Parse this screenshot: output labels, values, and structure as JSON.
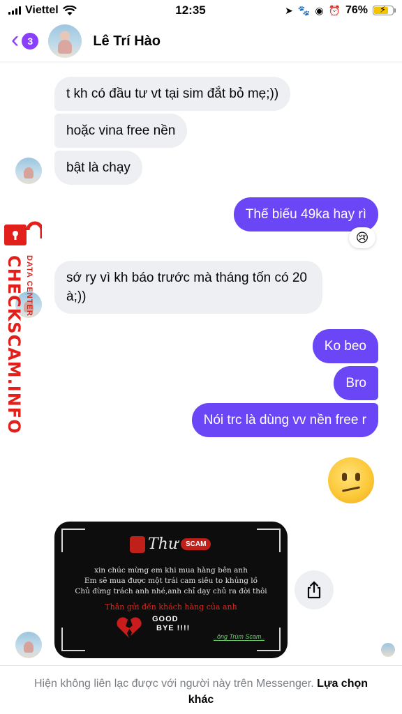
{
  "status_bar": {
    "carrier": "Viettel",
    "time": "12:35",
    "battery": "76%"
  },
  "header": {
    "unread_count": "3",
    "contact_name": "Lê Trí Hào"
  },
  "messages": [
    {
      "side": "in",
      "text": "t kh có đầu tư vt tại sim đắt bỏ mẹ;))"
    },
    {
      "side": "in",
      "text": "hoặc vina free nền"
    },
    {
      "side": "in",
      "text": "bật là chạy"
    },
    {
      "side": "out",
      "text": "Thế biếu 49ka hay rì",
      "reaction": "😢"
    },
    {
      "side": "in",
      "text": "sớ ry vì kh báo trước mà tháng tốn có 20 à;))"
    },
    {
      "side": "out",
      "text": "Ko beo"
    },
    {
      "side": "out",
      "text": "Bro"
    },
    {
      "side": "out",
      "text": "Nói trc là dùng vv nền free r"
    },
    {
      "side": "out",
      "emoji": "confused-face"
    }
  ],
  "image_card": {
    "brand": "Thư",
    "brand_badge": "SCAM",
    "line1": "xin chúc mừng em khi mua hàng bên anh",
    "line2": "Em sẽ mua được một trái cam siêu to khủng lồ",
    "line3": "Chủ đừng trách anh nhé,anh chỉ dạy chủ ra đời thôi",
    "red_line": "Thân gửi đến khách hàng của anh",
    "goodbye_1": "GOOD",
    "goodbye_2": "BYE !!!!",
    "signature": "_ông Trùm Scam_"
  },
  "watermark": {
    "main": "CHECKSCAM.INFO",
    "sub": "DATA CENTER"
  },
  "footer": {
    "notice": "Hiện không liên lạc được với người này trên Messenger.",
    "action": "Lựa chọn khác"
  },
  "colors": {
    "accent": "#8a3ffc",
    "outgoing_bubble": "#6b46f6",
    "incoming_bubble": "#eeeff2",
    "watermark": "#e1201b"
  }
}
